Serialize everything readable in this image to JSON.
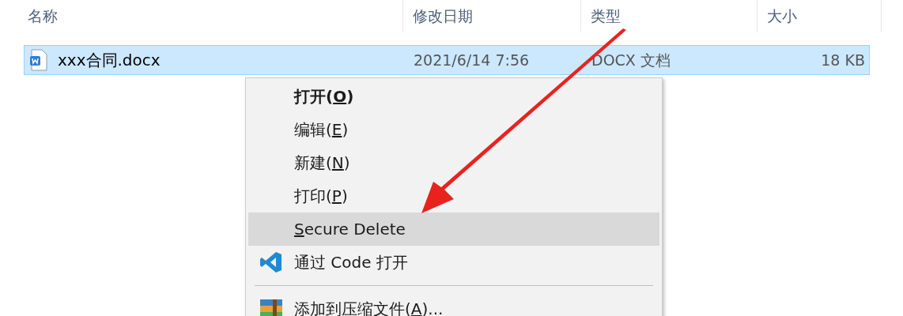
{
  "columns": [
    "名称",
    "修改日期",
    "类型",
    "大小"
  ],
  "file": {
    "name": "xxx合同.docx",
    "modified": "2021/6/14 7:56",
    "type": "DOCX 文档",
    "size": "18 KB",
    "selected": true
  },
  "context_menu": [
    {
      "kind": "plain",
      "before": "打开(",
      "key": "O",
      "after": ")",
      "default": true,
      "highlighted": false
    },
    {
      "kind": "plain",
      "before": "编辑(",
      "key": "E",
      "after": ")",
      "default": false,
      "highlighted": false
    },
    {
      "kind": "plain",
      "before": "新建(",
      "key": "N",
      "after": ")",
      "default": false,
      "highlighted": false
    },
    {
      "kind": "plain",
      "before": "打印(",
      "key": "P",
      "after": ")",
      "default": false,
      "highlighted": false
    },
    {
      "kind": "plain",
      "key": "S",
      "after": "ecure Delete",
      "default": false,
      "highlighted": true
    },
    {
      "kind": "code-app",
      "before": "通过 Code 打开",
      "default": false,
      "highlighted": false
    },
    {
      "kind": "separator"
    },
    {
      "kind": "archive-app",
      "before": "添加到压缩文件(",
      "key": "A",
      "after": ")...",
      "default": false,
      "highlighted": false
    }
  ]
}
